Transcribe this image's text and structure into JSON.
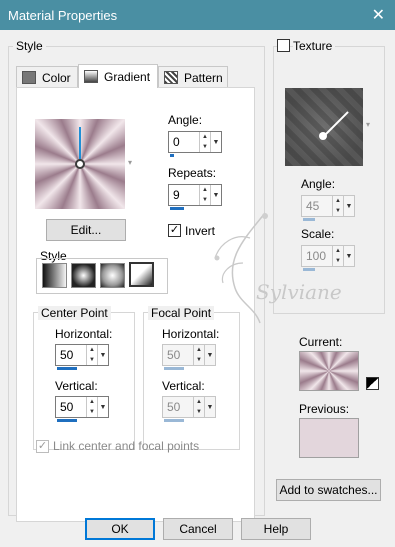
{
  "window": {
    "title": "Material Properties",
    "close_glyph": "✕"
  },
  "style_group": {
    "label": "Style"
  },
  "tabs": [
    {
      "label": "Color",
      "icon": "color-swatch-icon"
    },
    {
      "label": "Gradient",
      "icon": "gradient-icon"
    },
    {
      "label": "Pattern",
      "icon": "pattern-icon"
    }
  ],
  "gradient": {
    "angle_label": "Angle:",
    "angle_value": "0",
    "repeats_label": "Repeats:",
    "repeats_value": "9",
    "invert_label": "Invert",
    "invert_checked": true,
    "edit_button": "Edit...",
    "style_label": "Style",
    "style_options": [
      "linear-style-icon",
      "rectangular-style-icon",
      "sunburst-style-icon",
      "radial-style-icon"
    ],
    "selected_style": 3,
    "center_point": {
      "label": "Center Point",
      "horizontal_label": "Horizontal:",
      "horizontal_value": "50",
      "vertical_label": "Vertical:",
      "vertical_value": "50"
    },
    "focal_point": {
      "label": "Focal Point",
      "horizontal_label": "Horizontal:",
      "horizontal_value": "50",
      "vertical_label": "Vertical:",
      "vertical_value": "50"
    },
    "link_label": "Link center and focal points",
    "link_checked": true
  },
  "texture": {
    "label": "Texture",
    "checked": false,
    "angle_label": "Angle:",
    "angle_value": "45",
    "scale_label": "Scale:",
    "scale_value": "100"
  },
  "current_label": "Current:",
  "previous_label": "Previous:",
  "add_swatches_button": "Add to swatches...",
  "buttons": {
    "ok": "OK",
    "cancel": "Cancel",
    "help": "Help"
  },
  "watermark_text": "Sylviane",
  "colors": {
    "titlebar": "#4a8fa3",
    "gradient_light": "#f1e6ea",
    "gradient_dark": "#9b7c8c",
    "previous_swatch": "#e3d6dc",
    "accent": "#1f6fbf"
  }
}
